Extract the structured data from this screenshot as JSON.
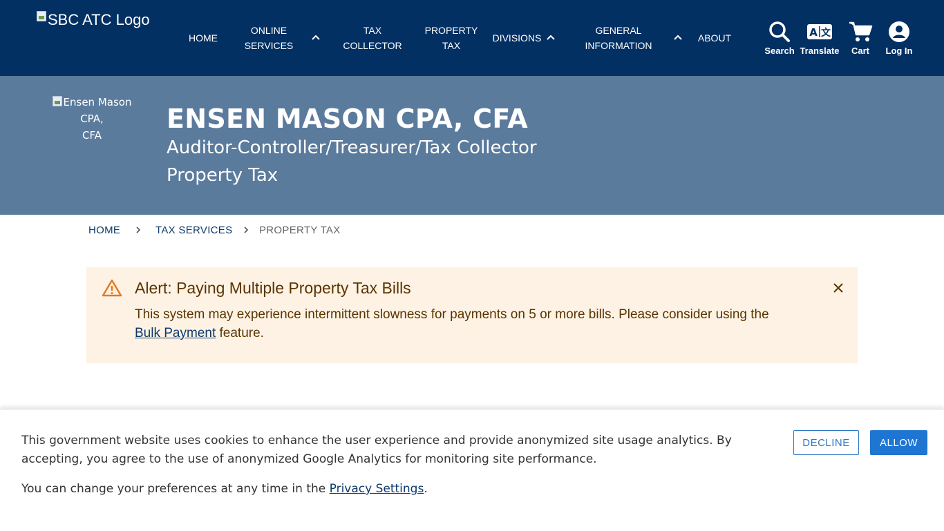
{
  "header": {
    "logo_alt": "SBC ATC Logo",
    "nav": [
      {
        "line1": "HOME",
        "line2": ""
      },
      {
        "line1": "ONLINE",
        "line2": "SERVICES"
      },
      {
        "line1": "TAX",
        "line2": "COLLECTOR"
      },
      {
        "line1": "PROPERTY",
        "line2": "TAX"
      },
      {
        "line1": "DIVISIONS",
        "line2": ""
      },
      {
        "line1": "GENERAL",
        "line2": "INFORMATION"
      },
      {
        "line1": "ABOUT",
        "line2": ""
      }
    ],
    "utilities": {
      "search": "Search",
      "translate": "Translate",
      "cart": "Cart",
      "login": "Log In"
    }
  },
  "hero": {
    "image_alt_line1": "Ensen Mason CPA,",
    "image_alt_line2": "CFA",
    "name": "ENSEN MASON CPA, CFA",
    "title": "Auditor-Controller/Treasurer/Tax Collector",
    "section": "Property Tax"
  },
  "breadcrumb": {
    "home": "HOME",
    "tax_services": "TAX SERVICES",
    "current": "PROPERTY TAX"
  },
  "alert": {
    "icon": "warning-icon",
    "title": "Alert: Paying Multiple Property Tax Bills",
    "body_before": "This system may experience intermittent slowness for payments on 5 or more bills. Please consider using the",
    "link": "Bulk Payment",
    "body_after": " feature."
  },
  "cookie_banner": {
    "message": "This government website uses cookies to enhance the user experience and provide anonymized site usage analytics. By accepting, you agree to the use of anonymized Google Analytics for monitoring site performance.",
    "prefs_before": "You can change your preferences at any time in the ",
    "prefs_link": "Privacy Settings",
    "prefs_after": ".",
    "decline": "DECLINE",
    "allow": "ALLOW"
  },
  "colors": {
    "nav_bg": "#033063",
    "hero_bg": "#5b7b9d",
    "alert_bg": "#fdf2e4",
    "alert_icon": "#e07b24",
    "allow_button": "#1f76d2"
  }
}
